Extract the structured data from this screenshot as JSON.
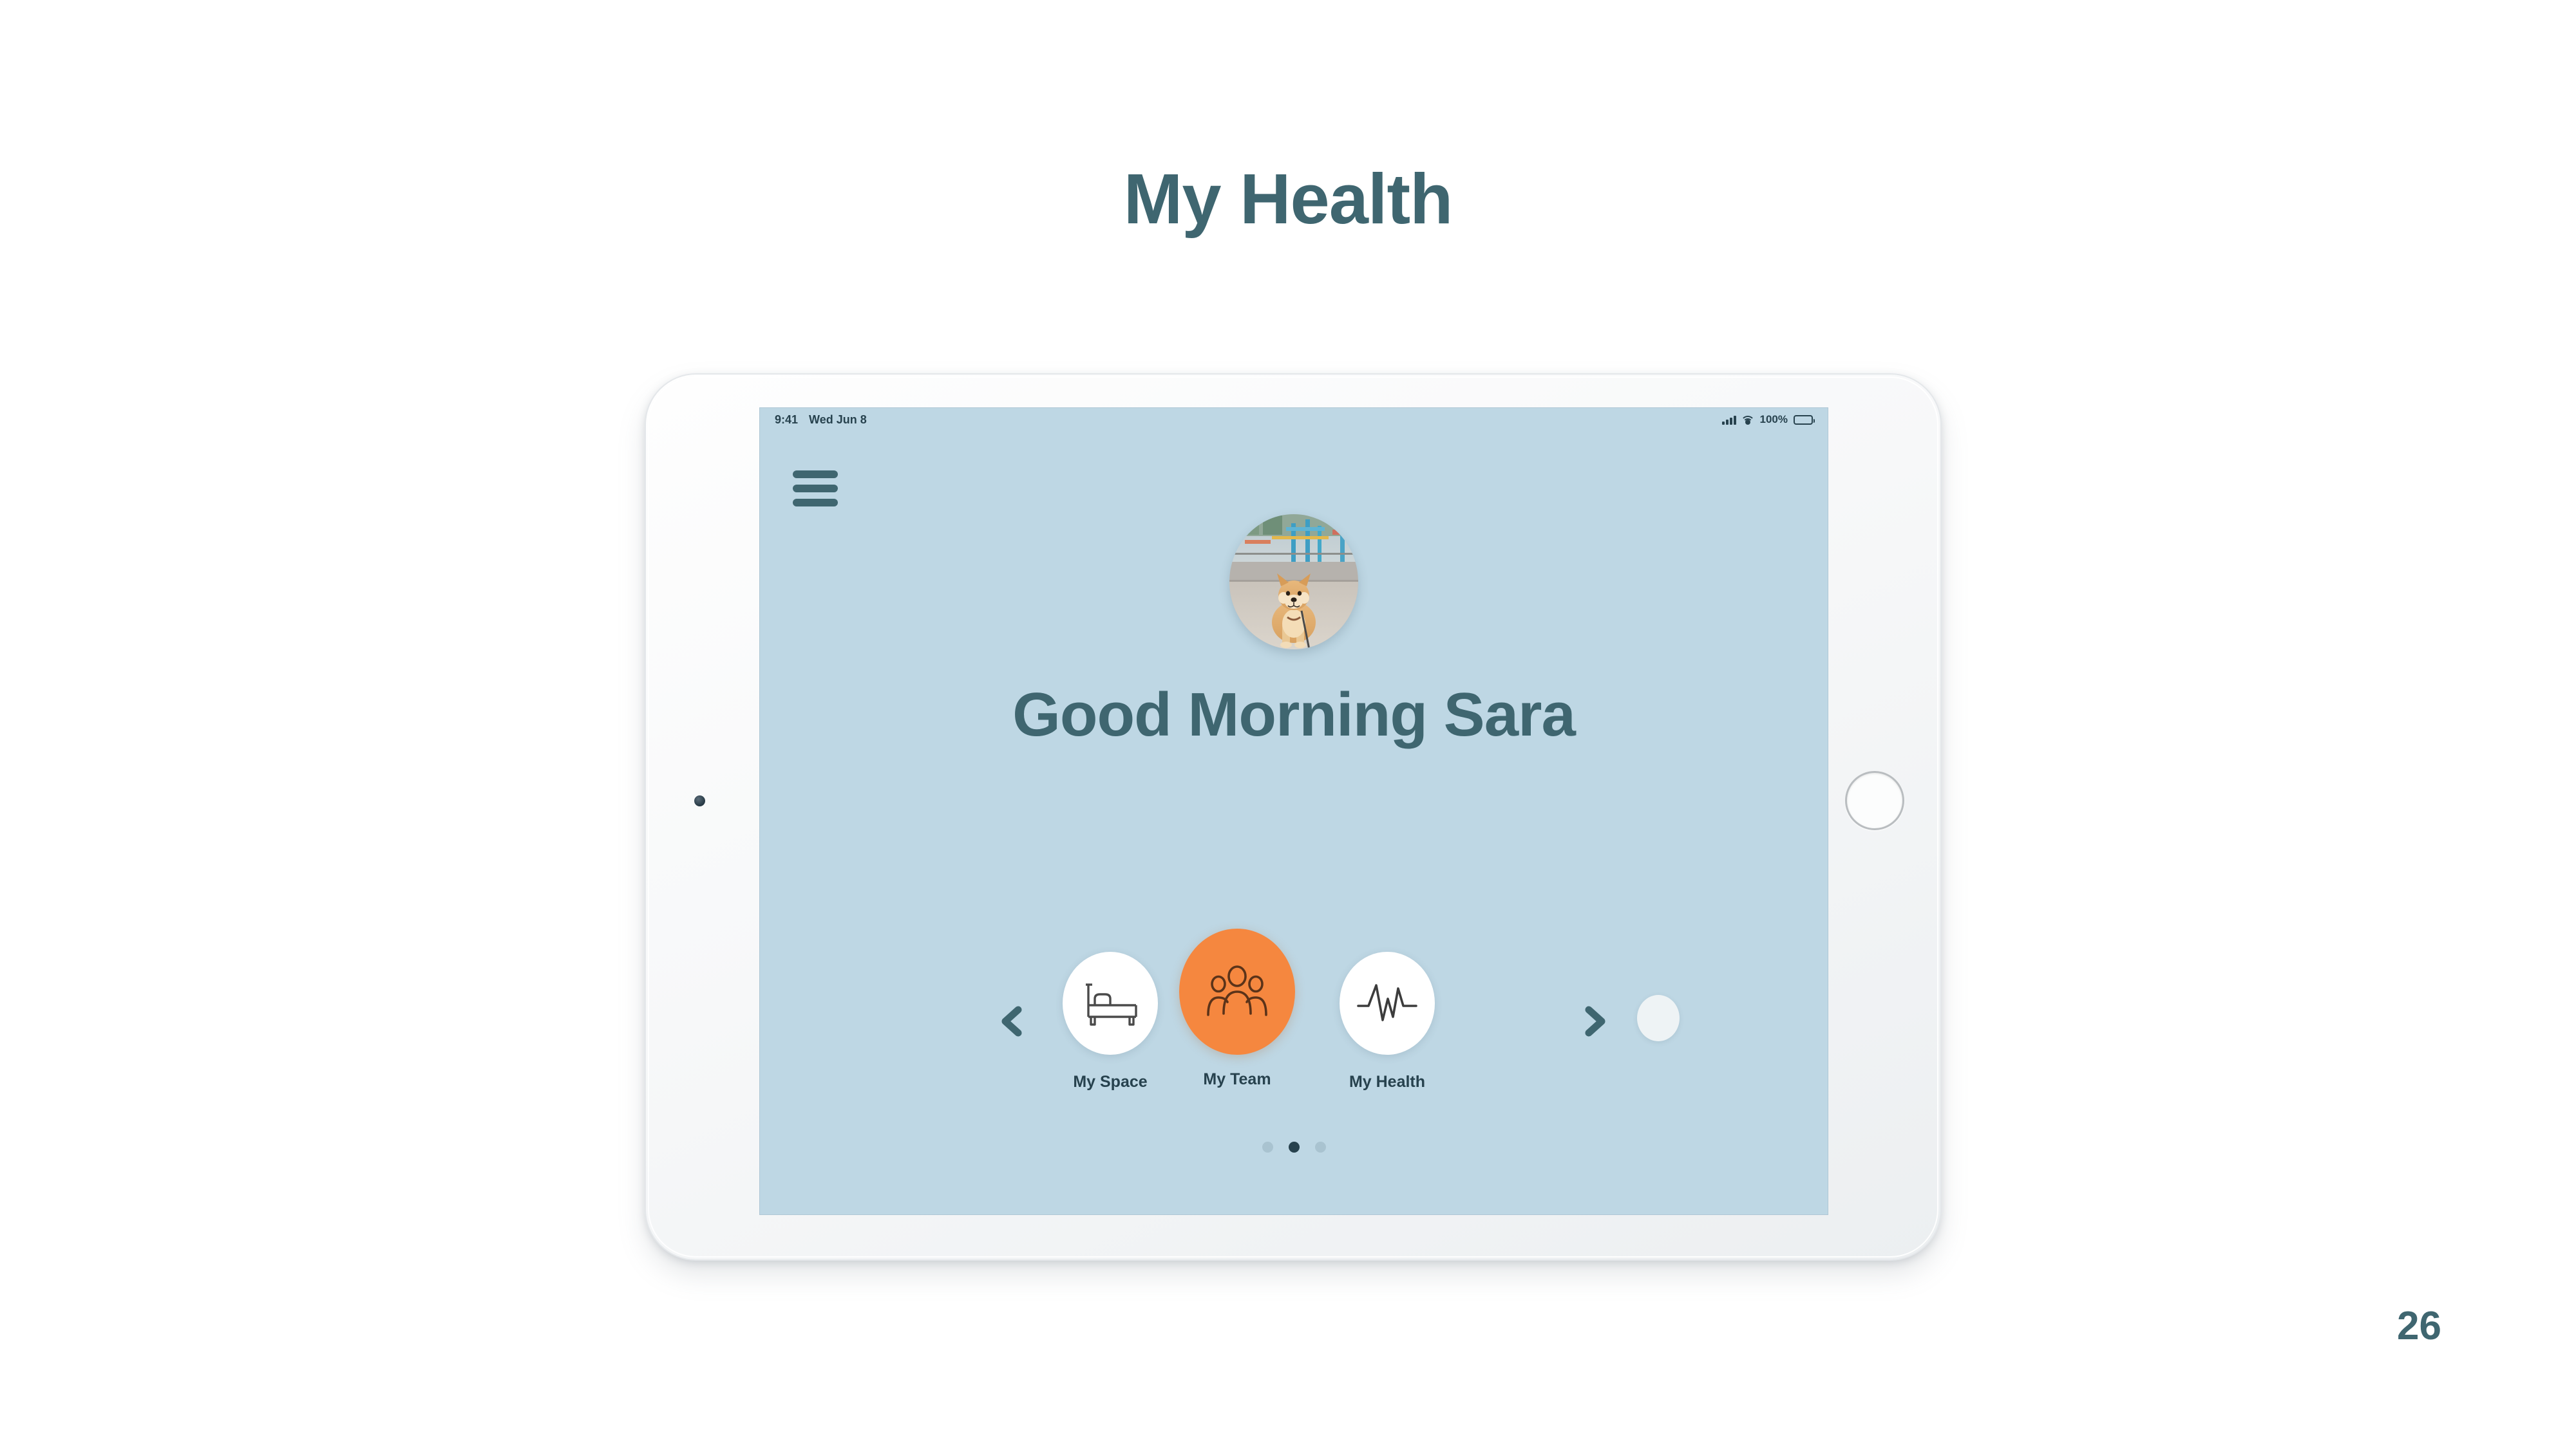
{
  "slide": {
    "title": "My Health",
    "page_number": "26"
  },
  "colors": {
    "title_slate": "#3f6670",
    "screen_bg": "#bed7e4",
    "accent_orange": "#f5873f",
    "text_dark": "#27424e",
    "dot_inactive": "#a9c3d0"
  },
  "device": {
    "status_bar": {
      "time": "9:41",
      "date": "Wed Jun 8",
      "battery_percent": "100%",
      "signal_icon": "cellular-signal-icon",
      "wifi_icon": "wifi-icon",
      "battery_icon": "battery-full-icon"
    },
    "home_button_icon": "home-button",
    "camera_icon": "front-camera"
  },
  "app": {
    "menu_icon": "hamburger-menu-icon",
    "avatar_alt": "dog-profile-photo",
    "greeting": "Good Morning Sara",
    "carousel": {
      "prev_icon": "chevron-left-icon",
      "next_icon": "chevron-right-icon",
      "items": [
        {
          "label": "My Space",
          "icon": "bed-icon",
          "active": false
        },
        {
          "label": "My Team",
          "icon": "people-group-icon",
          "active": true
        },
        {
          "label": "My Health",
          "icon": "heartbeat-ecg-icon",
          "active": false
        }
      ],
      "peek_item": "partial-next-card"
    },
    "pagination": {
      "total": 3,
      "active_index": 1
    }
  }
}
